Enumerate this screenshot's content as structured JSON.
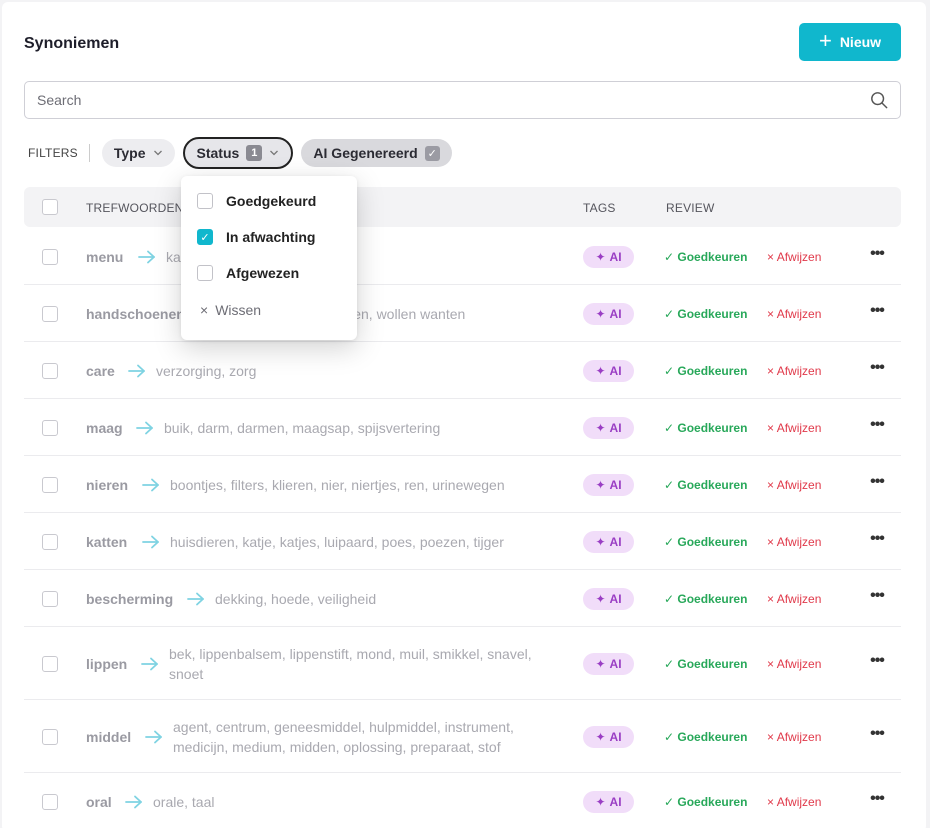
{
  "page": {
    "title": "Synoniemen",
    "new_button": "Nieuw"
  },
  "search": {
    "placeholder": "Search"
  },
  "filters": {
    "label": "FILTERS",
    "type": "Type",
    "status": "Status",
    "status_count": "1",
    "ai": "AI Gegenereerd"
  },
  "table": {
    "col_keywords": "TREFWOORDEN",
    "col_tags": "TAGS",
    "col_review": "REVIEW",
    "tag_label": "AI",
    "approve_label": "Goedkeuren",
    "reject_label": "Afwijzen",
    "rows": [
      {
        "keyword": "menu",
        "synonyms": "kaart"
      },
      {
        "keyword": "handschoenen",
        "synonyms": "wanten, handschoenen, wollen wanten"
      },
      {
        "keyword": "care",
        "synonyms": "verzorging, zorg"
      },
      {
        "keyword": "maag",
        "synonyms": "buik, darm, darmen, maagsap, spijsvertering"
      },
      {
        "keyword": "nieren",
        "synonyms": "boontjes, filters, klieren, nier, niertjes, ren, urinewegen"
      },
      {
        "keyword": "katten",
        "synonyms": "huisdieren, katje, katjes, luipaard, poes, poezen, tijger"
      },
      {
        "keyword": "bescherming",
        "synonyms": "dekking, hoede, veiligheid"
      },
      {
        "keyword": "lippen",
        "synonyms_lines": [
          "bek, lippenbalsem, lippenstift, mond, muil, smikkel, snavel,",
          "snoet"
        ]
      },
      {
        "keyword": "middel",
        "synonyms_lines": [
          "agent, centrum, geneesmiddel, hulpmiddel, instrument,",
          "medicijn, medium, midden, oplossing, preparaat, stof"
        ]
      },
      {
        "keyword": "oral",
        "synonyms": "orale, taal"
      }
    ]
  },
  "status_dropdown": {
    "options": [
      {
        "label": "Goedgekeurd",
        "checked": false
      },
      {
        "label": "In afwachting",
        "checked": true
      },
      {
        "label": "Afgewezen",
        "checked": false
      }
    ],
    "clear": "Wissen"
  },
  "colors": {
    "accent": "#10b7cd",
    "approve": "#28a85a",
    "reject": "#e0394a",
    "ai_tag": "#9a3ec4"
  }
}
